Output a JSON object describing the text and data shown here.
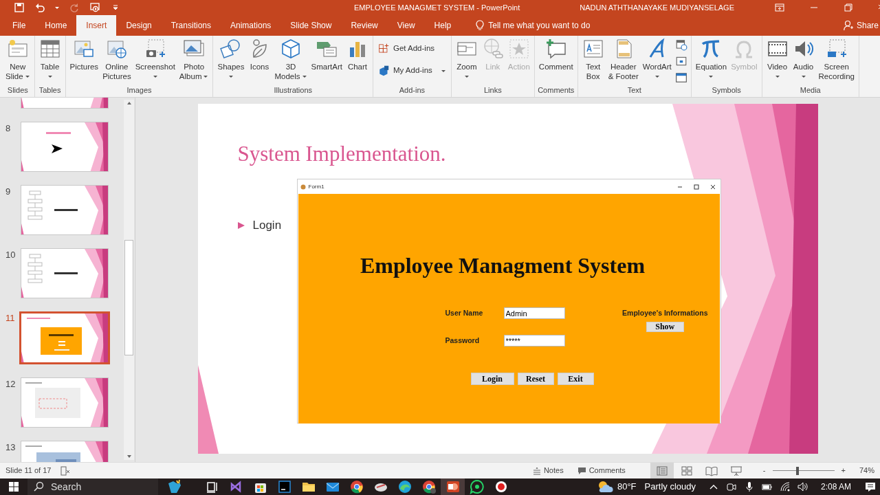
{
  "title_bar": {
    "quick_access": [
      {
        "disabled": false
      },
      {
        "disabled": false
      },
      {
        "disabled": false
      },
      {
        "disabled": true
      },
      {
        "disabled": false
      },
      {
        "disabled": false
      }
    ],
    "title": "EMPLOYEE MANAGMET SYSTEM - PowerPoint",
    "user": "NADUN ATHTHANAYAKE MUDIYANSELAGE"
  },
  "tabs": [
    {
      "label": "File",
      "selected": false
    },
    {
      "label": "Home",
      "selected": false
    },
    {
      "label": "Insert",
      "selected": true
    },
    {
      "label": "Design",
      "selected": false
    },
    {
      "label": "Transitions",
      "selected": false
    },
    {
      "label": "Animations",
      "selected": false
    },
    {
      "label": "Slide Show",
      "selected": false
    },
    {
      "label": "Review",
      "selected": false
    },
    {
      "label": "View",
      "selected": false
    },
    {
      "label": "Help",
      "selected": false
    }
  ],
  "tell_me": "Tell me what you want to do",
  "share": "Share",
  "ribbon": {
    "groups": [
      {
        "label": "Slides",
        "items": [
          {
            "kind": "large",
            "lines": [
              "New",
              "Slide"
            ],
            "dropdown": true,
            "disabled": false
          }
        ]
      },
      {
        "label": "Tables",
        "items": [
          {
            "kind": "large",
            "lines": [
              "Table"
            ],
            "dropdown": true,
            "disabled": false
          }
        ]
      },
      {
        "label": "Images",
        "items": [
          {
            "kind": "large",
            "lines": [
              "Pictures"
            ],
            "dropdown": false,
            "disabled": false
          },
          {
            "kind": "large",
            "lines": [
              "Online",
              "Pictures"
            ],
            "dropdown": false,
            "disabled": false
          },
          {
            "kind": "large",
            "lines": [
              "Screenshot"
            ],
            "dropdown": true,
            "disabled": false
          },
          {
            "kind": "large",
            "lines": [
              "Photo",
              "Album"
            ],
            "dropdown": true,
            "disabled": false
          }
        ]
      },
      {
        "label": "Illustrations",
        "items": [
          {
            "kind": "large",
            "lines": [
              "Shapes"
            ],
            "dropdown": true,
            "disabled": false
          },
          {
            "kind": "large",
            "lines": [
              "Icons"
            ],
            "dropdown": false,
            "disabled": false
          },
          {
            "kind": "large",
            "lines": [
              "3D",
              "Models"
            ],
            "dropdown": true,
            "disabled": false
          },
          {
            "kind": "large",
            "lines": [
              "SmartArt"
            ],
            "dropdown": false,
            "disabled": false
          },
          {
            "kind": "large",
            "lines": [
              "Chart"
            ],
            "dropdown": false,
            "disabled": false
          }
        ]
      },
      {
        "label": "Add-ins",
        "items": [
          {
            "kind": "small",
            "lines": [
              "Get Add-ins"
            ],
            "dropdown": false,
            "disabled": false
          },
          {
            "kind": "small",
            "lines": [
              "My Add-ins"
            ],
            "dropdown": true,
            "disabled": false
          }
        ]
      },
      {
        "label": "Links",
        "items": [
          {
            "kind": "large",
            "lines": [
              "Zoom"
            ],
            "dropdown": true,
            "disabled": false
          },
          {
            "kind": "large",
            "lines": [
              "Link"
            ],
            "dropdown": false,
            "disabled": true
          },
          {
            "kind": "large",
            "lines": [
              "Action"
            ],
            "dropdown": false,
            "disabled": true
          }
        ]
      },
      {
        "label": "Comments",
        "items": [
          {
            "kind": "large",
            "lines": [
              "Comment"
            ],
            "dropdown": false,
            "disabled": false
          }
        ]
      },
      {
        "label": "Text",
        "items": [
          {
            "kind": "large",
            "lines": [
              "Text",
              "Box"
            ],
            "dropdown": false,
            "disabled": false
          },
          {
            "kind": "large",
            "lines": [
              "Header",
              "& Footer"
            ],
            "dropdown": false,
            "disabled": false
          },
          {
            "kind": "large",
            "lines": [
              "WordArt"
            ],
            "dropdown": true,
            "disabled": false
          },
          {
            "kind": "icon",
            "disabled": false
          },
          {
            "kind": "icon",
            "disabled": false
          },
          {
            "kind": "icon",
            "disabled": false
          }
        ]
      },
      {
        "label": "Symbols",
        "items": [
          {
            "kind": "large",
            "lines": [
              "Equation"
            ],
            "dropdown": true,
            "disabled": false
          },
          {
            "kind": "large",
            "lines": [
              "Symbol"
            ],
            "dropdown": false,
            "disabled": true
          }
        ]
      },
      {
        "label": "Media",
        "items": [
          {
            "kind": "large",
            "lines": [
              "Video"
            ],
            "dropdown": true,
            "disabled": false
          },
          {
            "kind": "large",
            "lines": [
              "Audio"
            ],
            "dropdown": true,
            "disabled": false
          },
          {
            "kind": "large",
            "lines": [
              "Screen",
              "Recording"
            ],
            "dropdown": false,
            "disabled": false
          }
        ]
      }
    ]
  },
  "thumbnails": [
    {
      "kind": "partial",
      "selected": false
    },
    {
      "number": "8",
      "kind": "arrow",
      "selected": false
    },
    {
      "number": "9",
      "kind": "flowchart",
      "selected": false
    },
    {
      "number": "10",
      "kind": "flowchart",
      "selected": false
    },
    {
      "number": "11",
      "kind": "orange-form",
      "selected": true
    },
    {
      "number": "12",
      "kind": "grey-form",
      "selected": false
    },
    {
      "number": "13",
      "kind": "blue-form",
      "selected": false
    }
  ],
  "slide": {
    "title": "System Implementation.",
    "bullets": [
      "Login"
    ],
    "form": {
      "title": "Form1",
      "heading": "Employee Managment System",
      "fields": [
        {
          "label": "User Name",
          "value": "Admin"
        },
        {
          "label": "Password",
          "value": "*****"
        }
      ],
      "info_label": "Employee's Informations",
      "info_button": "Show",
      "buttons": [
        "Login",
        "Reset",
        "Exit"
      ]
    }
  },
  "status_bar": {
    "slide_counter": "Slide 11 of 17",
    "notes": "Notes",
    "comments": "Comments",
    "views": [
      {
        "selected": true
      },
      {
        "selected": false
      },
      {
        "selected": false
      },
      {
        "selected": false
      }
    ],
    "zoom": {
      "minus": "-",
      "plus": "+",
      "level": 0.4,
      "reading": "74%"
    }
  },
  "taskbar": {
    "search_placeholder": "Search",
    "apps": [
      {
        "active": false
      },
      {
        "active": false
      },
      {
        "active": false
      },
      {
        "active": false
      },
      {
        "active": false
      },
      {
        "active": false
      },
      {
        "active": false
      },
      {
        "active": false
      },
      {
        "active": false
      },
      {
        "active": false
      },
      {
        "active": false
      },
      {
        "active": true
      },
      {
        "active": false
      },
      {
        "active": false
      }
    ],
    "temperature": "80°F",
    "weather": "Partly cloudy",
    "time": "2:08 AM"
  }
}
